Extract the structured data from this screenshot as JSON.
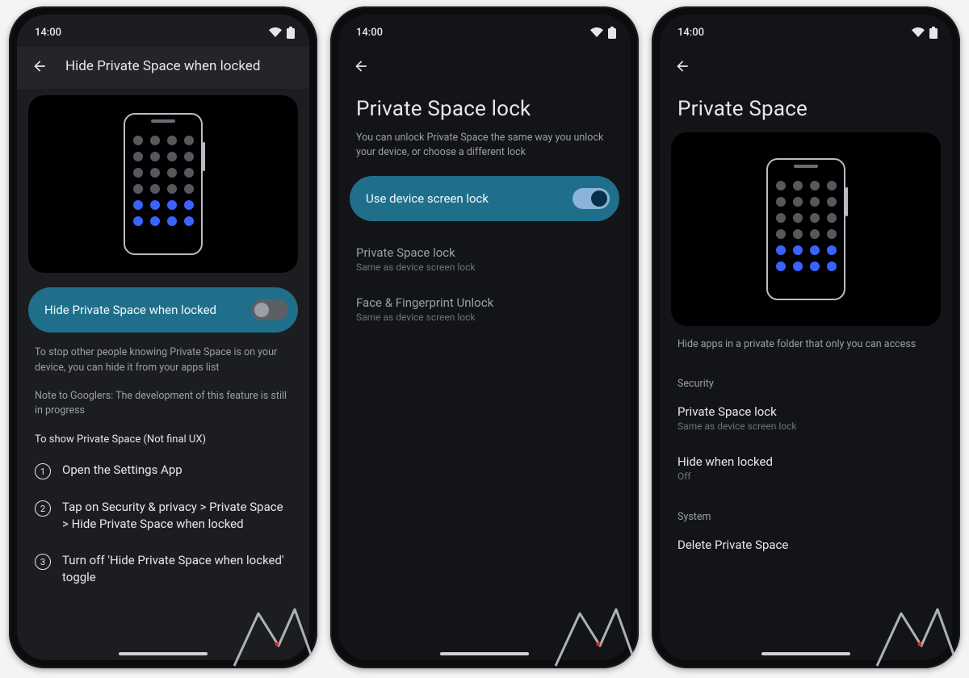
{
  "status": {
    "time": "14:00"
  },
  "phone1": {
    "appbar_title": "Hide Private Space when locked",
    "pill_label": "Hide Private Space when locked",
    "pill_state": "off",
    "para1": "To stop other people knowing Private Space is on your device, you can hide it from your apps list",
    "para2": "Note to Googlers: The development of this feature is still in progress",
    "steps_intro": "To show Private Space (Not final UX)",
    "steps": [
      "Open the Settings App",
      "Tap on Security & privacy > Private Space > Hide Private Space when locked",
      "Turn off 'Hide Private Space when locked' toggle"
    ]
  },
  "phone2": {
    "title": "Private Space lock",
    "subtitle": "You can unlock Private Space the same way you unlock your device, or choose a different lock",
    "pill_label": "Use device screen lock",
    "pill_state": "on",
    "row1_title": "Private Space lock",
    "row1_sub": "Same as device screen lock",
    "row2_title": "Face & Fingerprint Unlock",
    "row2_sub": "Same as device screen lock"
  },
  "phone3": {
    "title": "Private Space",
    "subtitle": "Hide apps in a private folder that only you can access",
    "section_security": "Security",
    "row_lock_title": "Private Space lock",
    "row_lock_sub": "Same as device screen lock",
    "row_hide_title": "Hide when locked",
    "row_hide_sub": "Off",
    "section_system": "System",
    "row_delete_title": "Delete Private Space"
  }
}
